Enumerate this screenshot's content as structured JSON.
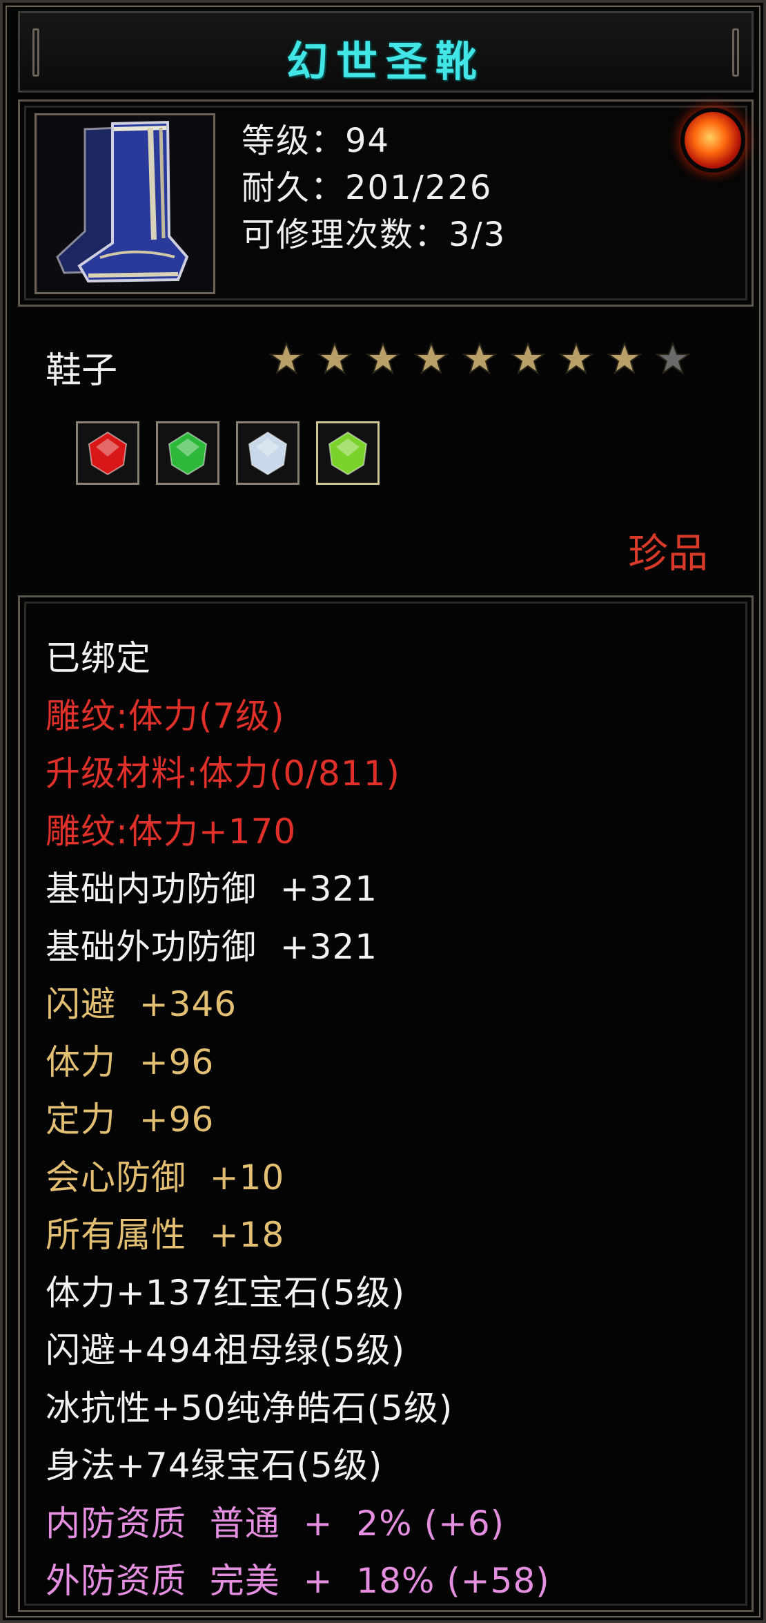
{
  "item": {
    "name": "幻世圣靴",
    "level_line": "等级：94",
    "durability_line": "耐久：201/226",
    "repair_line": "可修理次数：3/3",
    "type": "鞋子",
    "stars_filled": 8,
    "stars_total": 9,
    "rarity": "珍品",
    "icon": "boots-icon",
    "element_icon": "fire-orb-icon"
  },
  "gems": [
    {
      "name": "ruby-gem-icon",
      "color": "#d81818"
    },
    {
      "name": "emerald-gem-icon",
      "color": "#2eb83a"
    },
    {
      "name": "diamond-gem-icon",
      "color": "#c8d8e8"
    },
    {
      "name": "green-gem-icon",
      "color": "#7ad22a"
    }
  ],
  "colors": {
    "title": "#43e6e6",
    "white": "#f2f2f2",
    "red": "#e0302a",
    "gold": "#e2bf72",
    "pink": "#e48fe0",
    "star_filled": "#b8a068",
    "star_empty": "#6a6a6a"
  },
  "attributes": [
    {
      "text": "已绑定",
      "color": "white"
    },
    {
      "text": "雕纹:体力(7级)",
      "color": "red"
    },
    {
      "text": "升级材料:体力(0/811)",
      "color": "red"
    },
    {
      "text": "雕纹:体力+170",
      "color": "red"
    },
    {
      "text": "基础内功防御  +321",
      "color": "white"
    },
    {
      "text": "基础外功防御  +321",
      "color": "white"
    },
    {
      "text": "闪避  +346",
      "color": "gold"
    },
    {
      "text": "体力  +96",
      "color": "gold"
    },
    {
      "text": "定力  +96",
      "color": "gold"
    },
    {
      "text": "会心防御  +10",
      "color": "gold"
    },
    {
      "text": "所有属性  +18",
      "color": "gold"
    },
    {
      "text": "体力+137红宝石(5级)",
      "color": "white"
    },
    {
      "text": "闪避+494祖母绿(5级)",
      "color": "white"
    },
    {
      "text": "冰抗性+50纯净皓石(5级)",
      "color": "white"
    },
    {
      "text": "身法+74绿宝石(5级)",
      "color": "white"
    },
    {
      "text": "内防资质  普通  +  2% (+6)",
      "color": "pink"
    },
    {
      "text": "外防资质  完美  +  18% (+58)",
      "color": "pink"
    }
  ]
}
